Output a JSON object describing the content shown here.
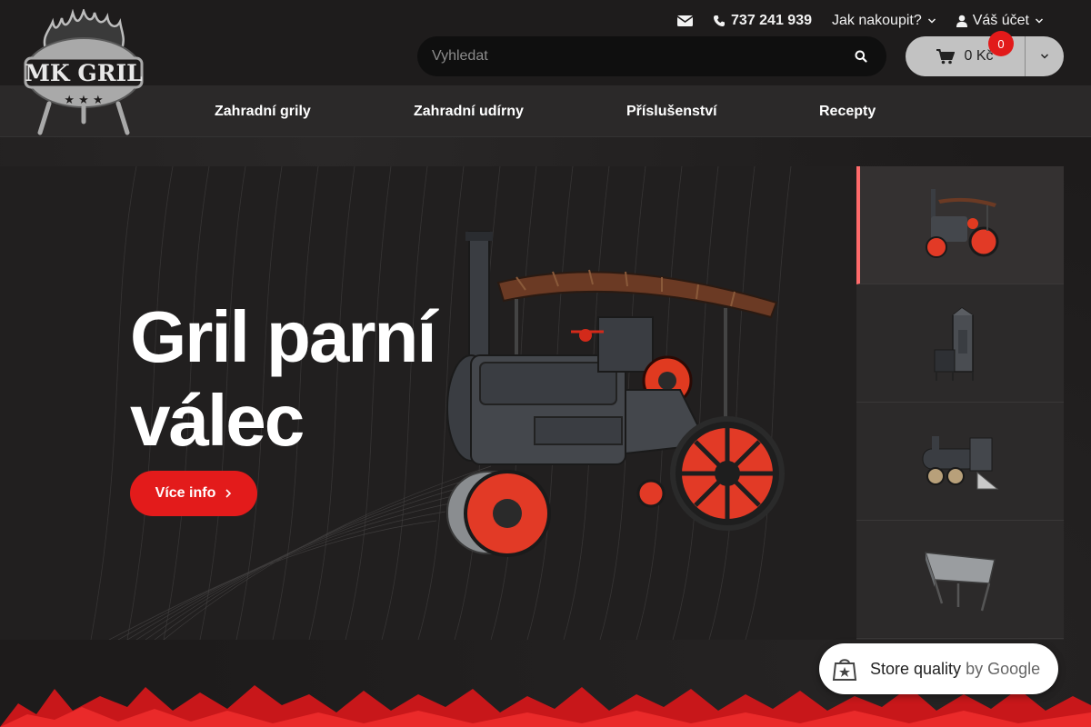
{
  "brand": {
    "logo_text": "MK GRIL"
  },
  "top_links": {
    "phone": "737 241 939",
    "how_to_buy": "Jak nakoupit?",
    "account": "Váš účet"
  },
  "search": {
    "placeholder": "Vyhledat"
  },
  "cart": {
    "total": "0 Kč",
    "count": "0"
  },
  "nav": {
    "items": [
      {
        "label": "Zahradní grily"
      },
      {
        "label": "Zahradní udírny"
      },
      {
        "label": "Příslušenství"
      },
      {
        "label": "Recepty"
      }
    ]
  },
  "hero": {
    "title_line1": "Gril parní",
    "title_line2": "válec",
    "button_label": "Více info"
  },
  "thumbnails": [
    {
      "name": "steam-roller-grill",
      "active": true
    },
    {
      "name": "smoker-tower",
      "active": false
    },
    {
      "name": "locomotive-grill",
      "active": false
    },
    {
      "name": "trough-grill",
      "active": false
    }
  ],
  "store_badge": {
    "label": "Store quality",
    "suffix": "by Google"
  },
  "colors": {
    "accent": "#e31b1b",
    "active_thumb": "#ff6b6b",
    "badge": "#e21a1a"
  }
}
